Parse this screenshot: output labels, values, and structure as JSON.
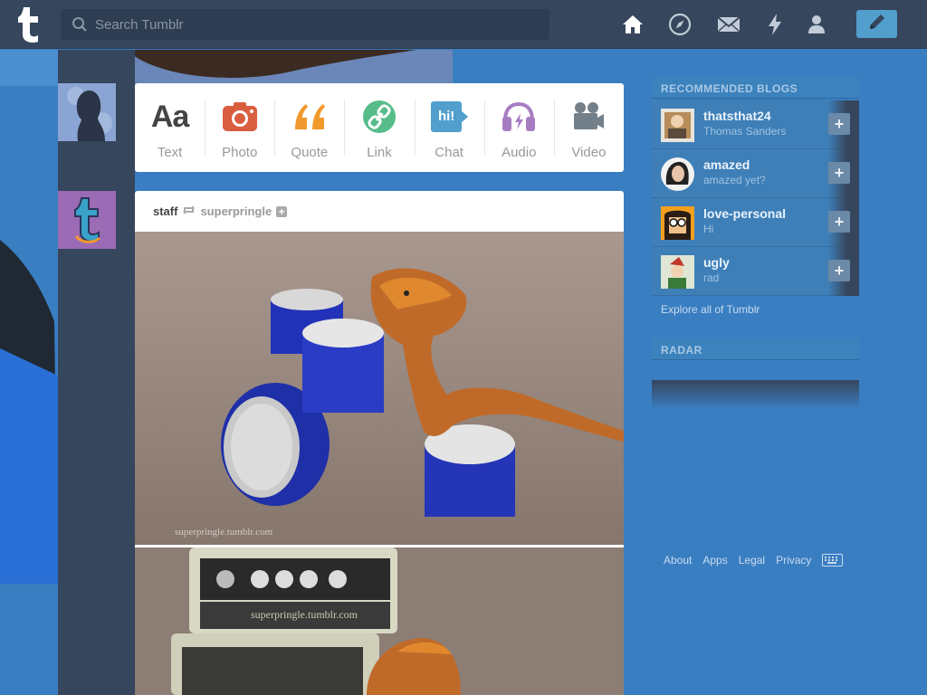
{
  "header": {
    "search_placeholder": "Search Tumblr",
    "logo_icon": "tumblr-logo",
    "nav_icons": [
      "home-icon",
      "compass-icon",
      "mail-icon",
      "lightning-icon",
      "account-icon"
    ],
    "compose_icon": "pencil-icon"
  },
  "post_bar": {
    "items": [
      {
        "label": "Text",
        "glyph": "Aa",
        "icon": "text-icon",
        "color": "#444444"
      },
      {
        "label": "Photo",
        "icon": "camera-icon",
        "color": "#d95e40"
      },
      {
        "label": "Quote",
        "glyph": "❝",
        "icon": "quote-icon",
        "color": "#f2992e"
      },
      {
        "label": "Link",
        "icon": "link-icon",
        "color": "#56bc8a"
      },
      {
        "label": "Chat",
        "glyph": "hi!",
        "icon": "chat-icon",
        "color": "#529ecc"
      },
      {
        "label": "Audio",
        "icon": "headphones-icon",
        "color": "#a77dc2"
      },
      {
        "label": "Video",
        "icon": "video-camera-icon",
        "color": "#748089"
      }
    ]
  },
  "post": {
    "author": "staff",
    "reblog_icon": "reblog-icon",
    "source": "superpringle",
    "follow_icon": "plus-icon",
    "watermark1": "superpringle.tumblr.com",
    "watermark2": "superpringle.tumblr.com"
  },
  "sidebar": {
    "recommended_title": "RECOMMENDED BLOGS",
    "blogs": [
      {
        "name": "thatsthat24",
        "subtitle": "Thomas Sanders"
      },
      {
        "name": "amazed",
        "subtitle": "amazed yet?"
      },
      {
        "name": "love-personal",
        "subtitle": "Hi"
      },
      {
        "name": "ugly",
        "subtitle": "rad"
      }
    ],
    "follow_label": "+",
    "explore": "Explore all of Tumblr",
    "radar_title": "RADAR"
  },
  "footer": {
    "links": [
      "About",
      "Apps",
      "Legal",
      "Privacy"
    ],
    "keyboard_icon": "keyboard-icon"
  },
  "colors": {
    "background": "#3a7ec2",
    "header": "#36465d",
    "compose": "#529ecc"
  }
}
